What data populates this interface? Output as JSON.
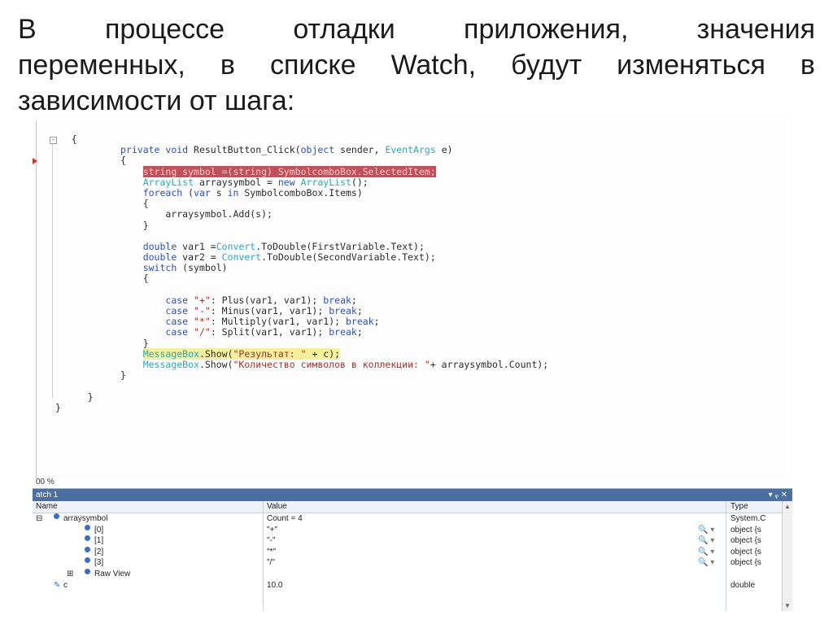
{
  "slide": {
    "line1": "В процессе отладки приложения, значения",
    "line2": "переменных, в списке Watch, будут изменяться в",
    "line3": "зависимости от шага:"
  },
  "code_lines": [
    {
      "t": "    {"
    },
    {
      "t": "private void ResultButton_Click(object sender, EventArgs e)"
    },
    {
      "t": "{"
    },
    {
      "t": "    string symbol =(string) SymbolcomboBox.SelectedItem;"
    },
    {
      "t": "    ArrayList arraysymbol = new ArrayList();"
    },
    {
      "t": "    foreach (var s in SymbolcomboBox.Items)"
    },
    {
      "t": "    {"
    },
    {
      "t": "        arraysymbol.Add(s);"
    },
    {
      "t": "    }"
    },
    {
      "t": ""
    },
    {
      "t": "    double var1 =Convert.ToDouble(FirstVariable.Text);"
    },
    {
      "t": "    double var2 = Convert.ToDouble(SecondVariable.Text);"
    },
    {
      "t": "    switch (symbol)"
    },
    {
      "t": "    {"
    },
    {
      "t": ""
    },
    {
      "t": "        case \"+\": Plus(var1, var1); break;"
    },
    {
      "t": "        case \"-\": Minus(var1, var1); break;"
    },
    {
      "t": "        case \"*\": Multiply(var1, var1); break;"
    },
    {
      "t": "        case \"/\": Split(var1, var1); break;"
    },
    {
      "t": "    }"
    },
    {
      "t": "    MessageBox.Show(\"Результат: \" + c);"
    },
    {
      "t": "    MessageBox.Show(\"Количество символов в коллекции: \"+ arraysymbol.Count);"
    },
    {
      "t": "}"
    },
    {
      "t": ""
    },
    {
      "t": "    }"
    },
    {
      "t": "}"
    }
  ],
  "zoom_level": "00 %",
  "watch": {
    "title": "atch 1",
    "controls": "▾ ᵩ ✕",
    "columns": {
      "name": "Name",
      "value": "Value",
      "type": "Type"
    },
    "rows": [
      {
        "expander": "⊟",
        "name": "arraysymbol",
        "value": "Count = 4",
        "type": "System.C",
        "mag": ""
      },
      {
        "expander": "",
        "name": "[0]",
        "value": "\"+\"",
        "type": "object {s",
        "mag": "🔍 ▾"
      },
      {
        "expander": "",
        "name": "[1]",
        "value": "\"-\"",
        "type": "object {s",
        "mag": "🔍 ▾"
      },
      {
        "expander": "",
        "name": "[2]",
        "value": "\"*\"",
        "type": "object {s",
        "mag": "🔍 ▾"
      },
      {
        "expander": "",
        "name": "[3]",
        "value": "\"/\"",
        "type": "object {s",
        "mag": "🔍 ▾"
      },
      {
        "expander": "⊞",
        "name": "Raw View",
        "value": "",
        "type": "",
        "mag": ""
      },
      {
        "expander": "",
        "name": "c",
        "value": "10.0",
        "type": "double",
        "mag": ""
      }
    ]
  },
  "colors": {
    "watch_titlebar": "#4b6ea3",
    "breakpoint_line": "#c0505a",
    "current_line": "#f3ef9a"
  }
}
